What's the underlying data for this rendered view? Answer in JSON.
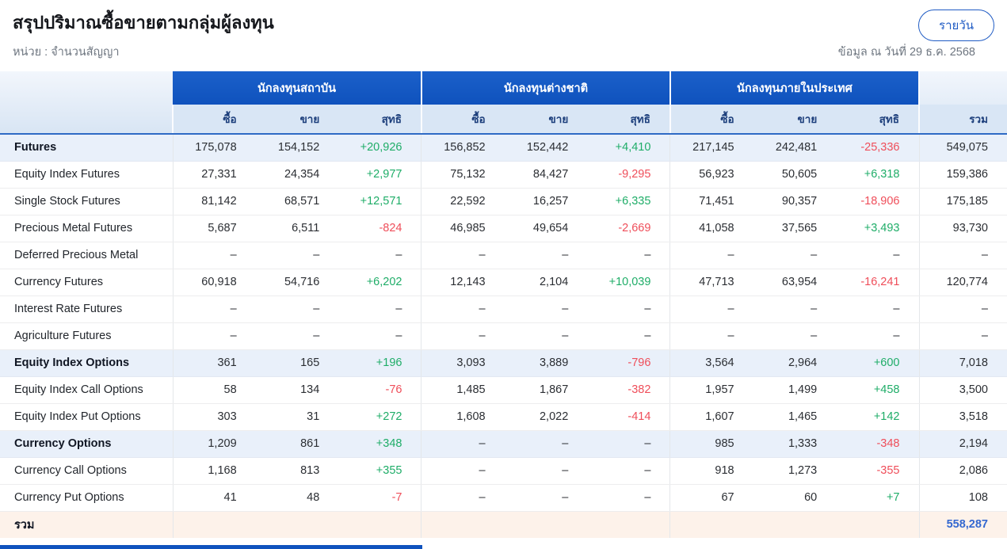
{
  "page": {
    "title": "สรุปปริมาณซื้อขายตามกลุ่มผู้ลงทุน",
    "unit_label": "หน่วย : จำนวนสัญญา",
    "as_of_label": "ข้อมูล ณ วันที่ 29 ธ.ค. 2568",
    "daily_button_label": "รายวัน"
  },
  "table": {
    "groups": [
      {
        "label": "นักลงทุนสถาบัน"
      },
      {
        "label": "นักลงทุนต่างชาติ"
      },
      {
        "label": "นักลงทุนภายในประเทศ"
      }
    ],
    "sub_headers": [
      "ซื้อ",
      "ขาย",
      "สุทธิ"
    ],
    "total_header": "รวม",
    "rows": [
      {
        "label": "Futures",
        "type": "section",
        "values": [
          "175,078",
          "154,152",
          "+20,926",
          "156,852",
          "152,442",
          "+4,410",
          "217,145",
          "242,481",
          "-25,336",
          "549,075"
        ]
      },
      {
        "label": "Equity Index Futures",
        "type": "sub",
        "values": [
          "27,331",
          "24,354",
          "+2,977",
          "75,132",
          "84,427",
          "-9,295",
          "56,923",
          "50,605",
          "+6,318",
          "159,386"
        ]
      },
      {
        "label": "Single Stock Futures",
        "type": "sub",
        "values": [
          "81,142",
          "68,571",
          "+12,571",
          "22,592",
          "16,257",
          "+6,335",
          "71,451",
          "90,357",
          "-18,906",
          "175,185"
        ]
      },
      {
        "label": "Precious Metal Futures",
        "type": "sub",
        "values": [
          "5,687",
          "6,511",
          "-824",
          "46,985",
          "49,654",
          "-2,669",
          "41,058",
          "37,565",
          "+3,493",
          "93,730"
        ]
      },
      {
        "label": "Deferred Precious Metal",
        "type": "sub",
        "values": [
          "–",
          "–",
          "–",
          "–",
          "–",
          "–",
          "–",
          "–",
          "–",
          "–"
        ]
      },
      {
        "label": "Currency Futures",
        "type": "sub",
        "values": [
          "60,918",
          "54,716",
          "+6,202",
          "12,143",
          "2,104",
          "+10,039",
          "47,713",
          "63,954",
          "-16,241",
          "120,774"
        ]
      },
      {
        "label": "Interest Rate Futures",
        "type": "sub",
        "values": [
          "–",
          "–",
          "–",
          "–",
          "–",
          "–",
          "–",
          "–",
          "–",
          "–"
        ]
      },
      {
        "label": "Agriculture Futures",
        "type": "sub",
        "values": [
          "–",
          "–",
          "–",
          "–",
          "–",
          "–",
          "–",
          "–",
          "–",
          "–"
        ]
      },
      {
        "label": "Equity Index Options",
        "type": "section",
        "values": [
          "361",
          "165",
          "+196",
          "3,093",
          "3,889",
          "-796",
          "3,564",
          "2,964",
          "+600",
          "7,018"
        ]
      },
      {
        "label": "Equity Index Call Options",
        "type": "sub",
        "values": [
          "58",
          "134",
          "-76",
          "1,485",
          "1,867",
          "-382",
          "1,957",
          "1,499",
          "+458",
          "3,500"
        ]
      },
      {
        "label": "Equity Index Put Options",
        "type": "sub",
        "values": [
          "303",
          "31",
          "+272",
          "1,608",
          "2,022",
          "-414",
          "1,607",
          "1,465",
          "+142",
          "3,518"
        ]
      },
      {
        "label": "Currency Options",
        "type": "section",
        "values": [
          "1,209",
          "861",
          "+348",
          "–",
          "–",
          "–",
          "985",
          "1,333",
          "-348",
          "2,194"
        ]
      },
      {
        "label": "Currency Call Options",
        "type": "sub",
        "values": [
          "1,168",
          "813",
          "+355",
          "–",
          "–",
          "–",
          "918",
          "1,273",
          "-355",
          "2,086"
        ]
      },
      {
        "label": "Currency Put Options",
        "type": "sub",
        "values": [
          "41",
          "48",
          "-7",
          "–",
          "–",
          "–",
          "67",
          "60",
          "+7",
          "108"
        ]
      },
      {
        "label": "รวม",
        "type": "total",
        "values": [
          "",
          "",
          "",
          "",
          "",
          "",
          "",
          "",
          "",
          "558,287"
        ]
      }
    ]
  },
  "colors": {
    "header_blue": "#1b60ca",
    "header_blue_dark": "#0f52bd",
    "subheader_bg": "#d9e6f5",
    "subheader_text": "#1d3f7c",
    "divider_blue": "#2e6ac5",
    "section_row_bg": "#e9f0fa",
    "total_row_bg": "#fdf2ea",
    "positive_green": "#1fad68",
    "negative_red": "#ef4e5a",
    "total_blue": "#3468d0",
    "accent_blue": "#1f5bc4",
    "text_gray": "#6e7680"
  }
}
